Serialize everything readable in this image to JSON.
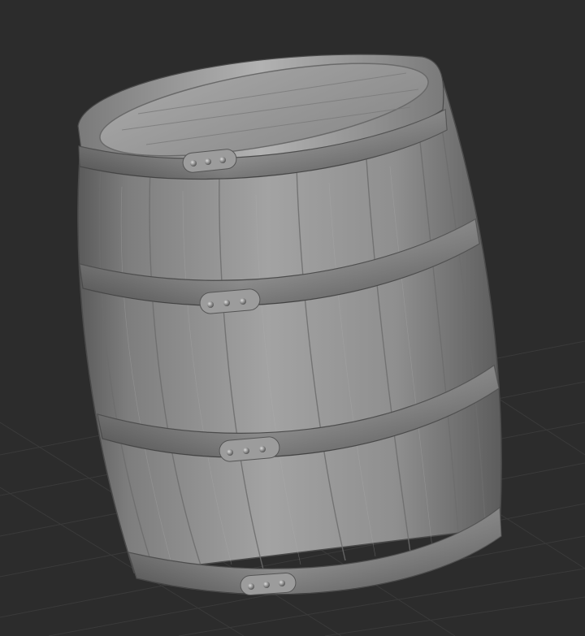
{
  "viewport": {
    "background": "#2c2c2c",
    "grid_color": "#3a3a3a"
  },
  "model": {
    "subject": "wooden-barrel",
    "material_base": "#9a9a9a",
    "material_shadow": "#4e4e4e",
    "hoop_color": "#8e8e8e",
    "hoop_count": 4,
    "rivets_per_hoop": 3,
    "stave_count": 9
  }
}
